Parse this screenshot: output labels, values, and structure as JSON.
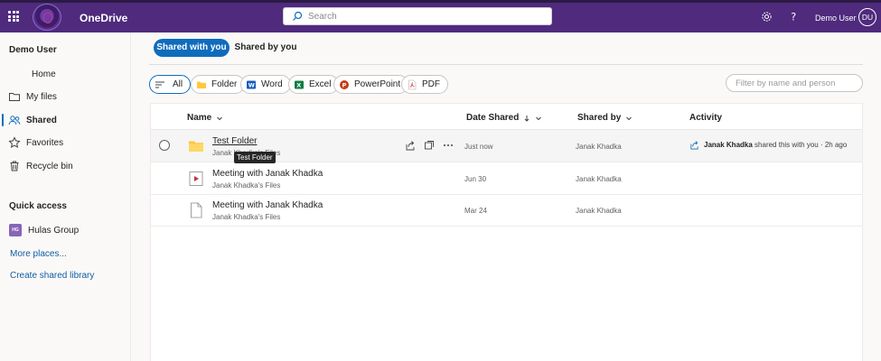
{
  "app": {
    "name": "OneDrive",
    "accent": "#4f2a7d",
    "primary": "#0f6cbd"
  },
  "topbar": {
    "search_placeholder": "Search",
    "user_name": "Demo User",
    "avatar_initials": "DU"
  },
  "sidebar": {
    "user": "Demo User",
    "items": [
      {
        "label": "Home",
        "icon": "home-icon"
      },
      {
        "label": "My files",
        "icon": "folder-icon"
      },
      {
        "label": "Shared",
        "icon": "people-icon",
        "active": true
      },
      {
        "label": "Favorites",
        "icon": "star-icon"
      },
      {
        "label": "Recycle bin",
        "icon": "trash-icon"
      }
    ],
    "quick_access_title": "Quick access",
    "group": {
      "badge": "HG",
      "label": "Hulas Group"
    },
    "more_places": "More places...",
    "create_library": "Create shared library"
  },
  "tabs": {
    "shared_with_you": "Shared with you",
    "shared_by_you": "Shared by you"
  },
  "filters": {
    "chips": [
      "All",
      "Folder",
      "Word",
      "Excel",
      "PowerPoint",
      "PDF"
    ],
    "selected": "All",
    "filter_placeholder": "Filter by name and person"
  },
  "table": {
    "headers": {
      "name": "Name",
      "date_shared": "Date Shared",
      "shared_by": "Shared by",
      "activity": "Activity"
    },
    "rows": [
      {
        "name": "Test Folder",
        "location": "Janak Khadka's Files",
        "date": "Just now",
        "shared_by": "Janak Khadka",
        "activity_person": "Janak Khadka",
        "activity_text": "shared this with you · 2h ago",
        "type": "folder"
      },
      {
        "name": "Meeting with Janak Khadka",
        "location": "Janak Khadka's Files",
        "date": "Jun 30",
        "shared_by": "Janak Khadka",
        "type": "video"
      },
      {
        "name": "Meeting with Janak Khadka",
        "location": "Janak Khadka's Files",
        "date": "Mar 24",
        "shared_by": "Janak Khadka",
        "type": "file"
      }
    ],
    "tooltip": "Test Folder"
  }
}
